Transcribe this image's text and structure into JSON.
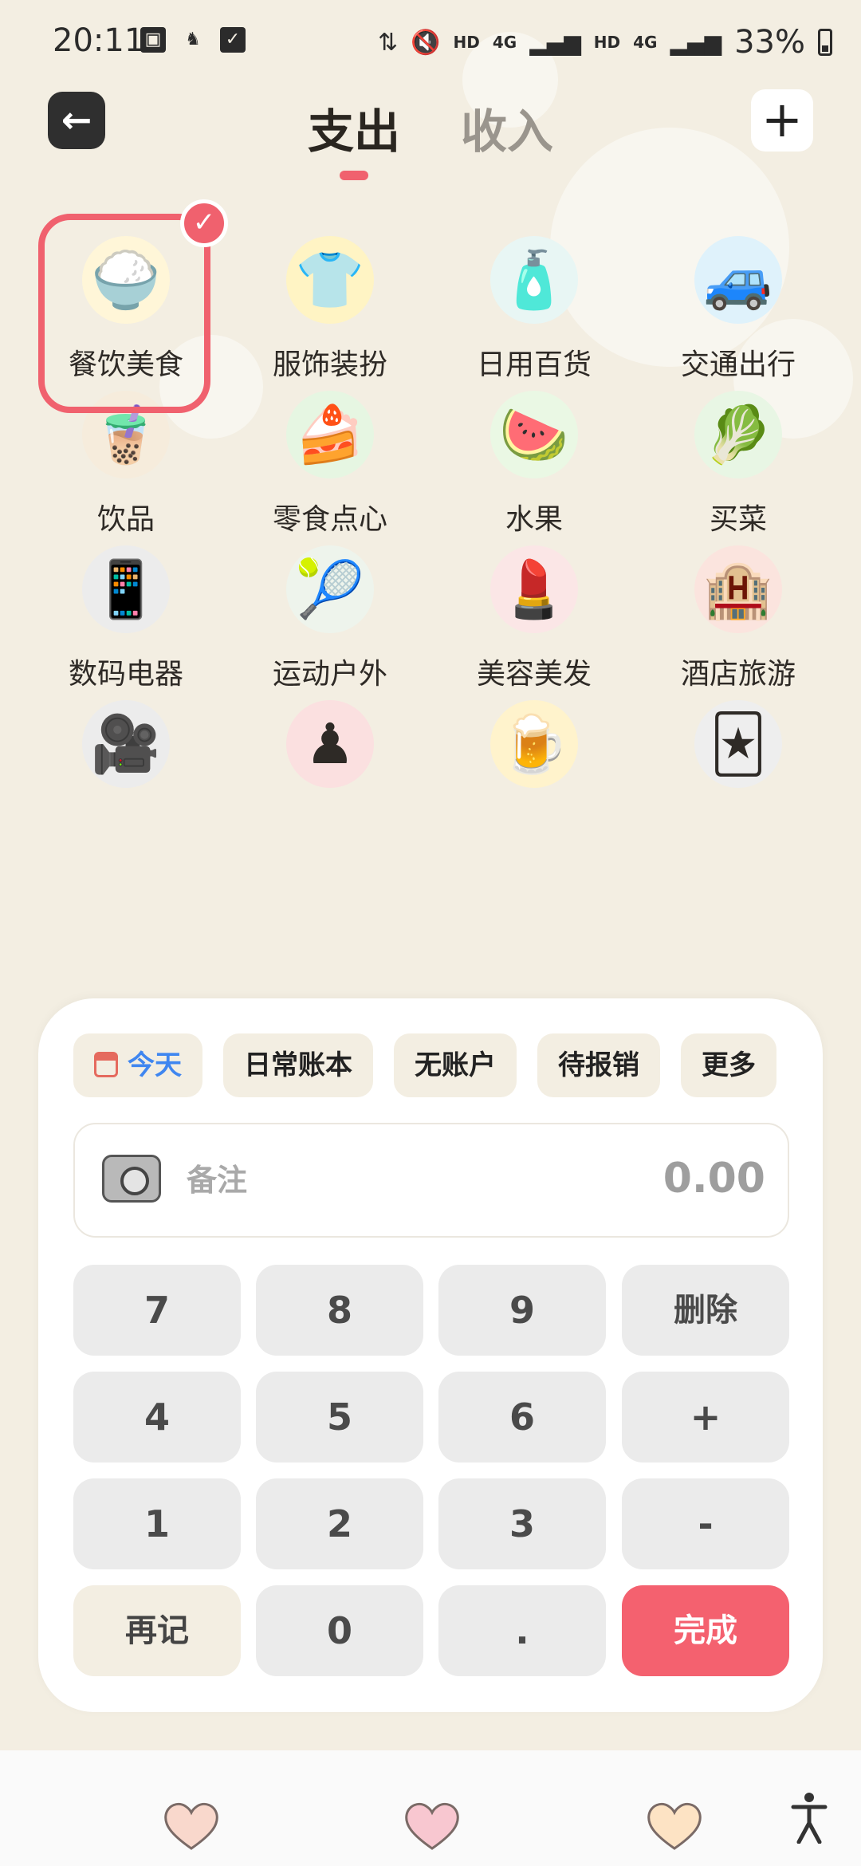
{
  "status_bar": {
    "time": "20:11",
    "network_1": "HD",
    "network_1_type": "4G",
    "network_2": "HD",
    "network_2_type": "4G",
    "battery": "33%"
  },
  "header": {
    "tabs": [
      {
        "label": "支出",
        "active": true
      },
      {
        "label": "收入",
        "active": false
      }
    ]
  },
  "categories": [
    {
      "label": "餐饮美食",
      "icon": "rice-bowl-icon",
      "glyph": "🍚",
      "bg": "#fff6d8",
      "selected": true
    },
    {
      "label": "服饰装扮",
      "icon": "clothing-icon",
      "glyph": "👕",
      "bg": "#fff4c4"
    },
    {
      "label": "日用百货",
      "icon": "soap-bottle-icon",
      "glyph": "🧴",
      "bg": "#e8f6f4"
    },
    {
      "label": "交通出行",
      "icon": "car-icon",
      "glyph": "🚙",
      "bg": "#dff2fb"
    },
    {
      "label": "饮品",
      "icon": "bubble-tea-icon",
      "glyph": "🧋",
      "bg": "#f6ecdc"
    },
    {
      "label": "零食点心",
      "icon": "cake-icon",
      "glyph": "🍰",
      "bg": "#e6f6e2"
    },
    {
      "label": "水果",
      "icon": "fruit-icon",
      "glyph": "🍉",
      "bg": "#eaf8e4"
    },
    {
      "label": "买菜",
      "icon": "vegetable-icon",
      "glyph": "🥬",
      "bg": "#e8f6e4"
    },
    {
      "label": "数码电器",
      "icon": "phone-icon",
      "glyph": "📱",
      "bg": "#ececec"
    },
    {
      "label": "运动户外",
      "icon": "sports-icon",
      "glyph": "🎾",
      "bg": "#eef4ec"
    },
    {
      "label": "美容美发",
      "icon": "cosmetics-icon",
      "glyph": "💄",
      "bg": "#fbe6e6"
    },
    {
      "label": "酒店旅游",
      "icon": "hotel-icon",
      "glyph": "🏨",
      "bg": "#fbe4de"
    },
    {
      "label": "",
      "icon": "projector-icon",
      "glyph": "🎥",
      "bg": "#ececec"
    },
    {
      "label": "",
      "icon": "game-piece-icon",
      "glyph": "♟",
      "bg": "#fbe0e0"
    },
    {
      "label": "",
      "icon": "beer-icon",
      "glyph": "🍺",
      "bg": "#fff3cc"
    },
    {
      "label": "",
      "icon": "playing-cards-icon",
      "glyph": "🃏",
      "bg": "#eeeeee"
    }
  ],
  "panel": {
    "chips": [
      {
        "label": "今天",
        "name": "chip-today"
      },
      {
        "label": "日常账本",
        "name": "chip-ledger"
      },
      {
        "label": "无账户",
        "name": "chip-account"
      },
      {
        "label": "待报销",
        "name": "chip-reimburse"
      },
      {
        "label": "更多",
        "name": "chip-more"
      }
    ],
    "note_placeholder": "备注",
    "amount": "0.00",
    "keys": {
      "k7": "7",
      "k8": "8",
      "k9": "9",
      "delete": "删除",
      "k4": "4",
      "k5": "5",
      "k6": "6",
      "plus": "+",
      "k1": "1",
      "k2": "2",
      "k3": "3",
      "minus": "-",
      "again": "再记",
      "k0": "0",
      "dot": ".",
      "done": "完成"
    }
  },
  "colors": {
    "accent": "#f0616e",
    "background": "#f3eee2",
    "today_blue": "#3f86f0"
  },
  "bottom_bar": {
    "hearts": [
      "#f9d8cc",
      "#f8c7d0",
      "#fde3c4"
    ]
  }
}
